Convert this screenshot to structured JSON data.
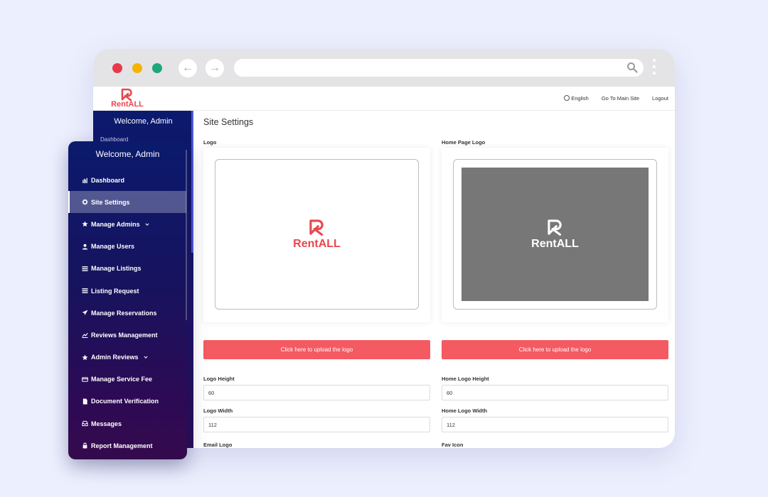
{
  "browser": {
    "back_glyph": "←",
    "forward_glyph": "→",
    "url": "",
    "window_dots": [
      "#e8394a",
      "#f4b400",
      "#1fa67a"
    ]
  },
  "site": {
    "brand": "RentALL",
    "brand_color": "#e8474f",
    "header_links": {
      "language": "English",
      "main_site": "Go To Main Site",
      "logout": "Logout"
    }
  },
  "bg_sidebar": {
    "welcome": "Welcome, Admin",
    "first_item": "Dashboard"
  },
  "main": {
    "page_title": "Site Settings",
    "left": {
      "logo_label": "Logo",
      "logo_preview_text": "RentALL",
      "upload_label": "Click here to upload the logo",
      "height_label": "Logo Height",
      "height_value": "60",
      "width_label": "Logo Width",
      "width_value": "112",
      "next_label": "Email Logo"
    },
    "right": {
      "logo_label": "Home Page Logo",
      "logo_preview_text": "RentALL",
      "upload_label": "Click here to upload the logo",
      "height_label": "Home Logo Height",
      "height_value": "60",
      "width_label": "Home Logo Width",
      "width_value": "112",
      "next_label": "Fav Icon"
    },
    "accent_color": "#f45a62"
  },
  "sidebar": {
    "welcome": "Welcome, Admin",
    "items": [
      {
        "label": "Dashboard",
        "icon": "bar-chart-icon"
      },
      {
        "label": "Site Settings",
        "icon": "gear-icon",
        "active": true
      },
      {
        "label": "Manage Admins",
        "icon": "star-icon",
        "has_submenu": true
      },
      {
        "label": "Manage Users",
        "icon": "user-icon"
      },
      {
        "label": "Manage Listings",
        "icon": "list-icon"
      },
      {
        "label": "Listing Request",
        "icon": "list-icon"
      },
      {
        "label": "Manage Reservations",
        "icon": "plane-icon"
      },
      {
        "label": "Reviews Management",
        "icon": "line-chart-icon"
      },
      {
        "label": "Admin Reviews",
        "icon": "star-icon",
        "has_submenu": true
      },
      {
        "label": "Manage Service Fee",
        "icon": "credit-card-icon"
      },
      {
        "label": "Document Verification",
        "icon": "file-icon"
      },
      {
        "label": "Messages",
        "icon": "inbox-icon"
      },
      {
        "label": "Report Management",
        "icon": "lock-icon"
      }
    ]
  }
}
